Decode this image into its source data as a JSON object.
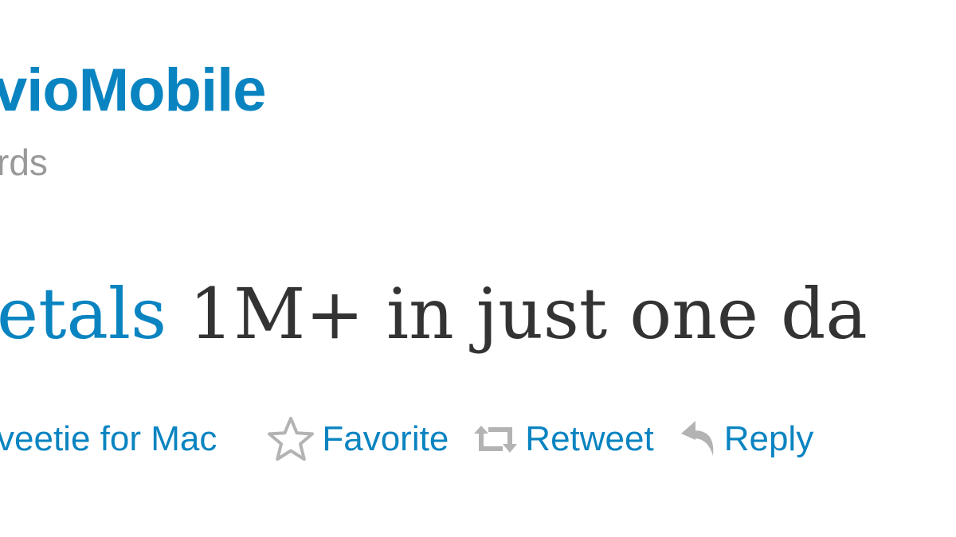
{
  "tweet": {
    "username": "vioMobile",
    "fullname": "rds",
    "text_link": "etals",
    "text_rest": " 1M+ in just one da",
    "source": "veetie for Mac"
  },
  "actions": {
    "favorite": {
      "label": "Favorite",
      "icon": "star-icon"
    },
    "retweet": {
      "label": "Retweet",
      "icon": "retweet-icon"
    },
    "reply": {
      "label": "Reply",
      "icon": "reply-icon"
    }
  },
  "colors": {
    "link": "#0a84c1",
    "text": "#333333",
    "muted": "#999999",
    "icon": "#b3b3b3"
  }
}
